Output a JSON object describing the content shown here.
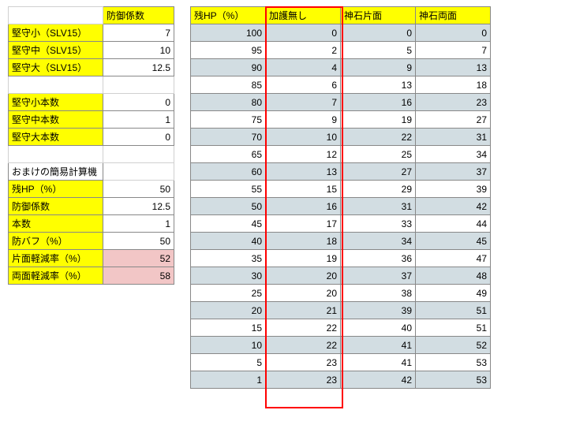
{
  "left": {
    "header1": "防御係数",
    "r1": {
      "label": "堅守小（SLV15）",
      "val": "7"
    },
    "r2": {
      "label": "堅守中（SLV15）",
      "val": "10"
    },
    "r3": {
      "label": "堅守大（SLV15）",
      "val": "12.5"
    },
    "r4": {
      "label": "堅守小本数",
      "val": "0"
    },
    "r5": {
      "label": "堅守中本数",
      "val": "1"
    },
    "r6": {
      "label": "堅守大本数",
      "val": "0"
    },
    "calc_title": "おまけの簡易計算機",
    "c1": {
      "label": "残HP（%）",
      "val": "50"
    },
    "c2": {
      "label": "防御係数",
      "val": "12.5"
    },
    "c3": {
      "label": "本数",
      "val": "1"
    },
    "c4": {
      "label": "防バフ（%）",
      "val": "50"
    },
    "c5": {
      "label": "片面軽減率（%）",
      "val": "52"
    },
    "c6": {
      "label": "両面軽減率（%）",
      "val": "58"
    }
  },
  "right": {
    "headers": {
      "h1": "残HP（%）",
      "h2": "加護無し",
      "h3": "神石片面",
      "h4": "神石両面"
    },
    "rows": [
      {
        "hp": "100",
        "a": "0",
        "b": "0",
        "c": "0"
      },
      {
        "hp": "95",
        "a": "2",
        "b": "5",
        "c": "7"
      },
      {
        "hp": "90",
        "a": "4",
        "b": "9",
        "c": "13"
      },
      {
        "hp": "85",
        "a": "6",
        "b": "13",
        "c": "18"
      },
      {
        "hp": "80",
        "a": "7",
        "b": "16",
        "c": "23"
      },
      {
        "hp": "75",
        "a": "9",
        "b": "19",
        "c": "27"
      },
      {
        "hp": "70",
        "a": "10",
        "b": "22",
        "c": "31"
      },
      {
        "hp": "65",
        "a": "12",
        "b": "25",
        "c": "34"
      },
      {
        "hp": "60",
        "a": "13",
        "b": "27",
        "c": "37"
      },
      {
        "hp": "55",
        "a": "15",
        "b": "29",
        "c": "39"
      },
      {
        "hp": "50",
        "a": "16",
        "b": "31",
        "c": "42"
      },
      {
        "hp": "45",
        "a": "17",
        "b": "33",
        "c": "44"
      },
      {
        "hp": "40",
        "a": "18",
        "b": "34",
        "c": "45"
      },
      {
        "hp": "35",
        "a": "19",
        "b": "36",
        "c": "47"
      },
      {
        "hp": "30",
        "a": "20",
        "b": "37",
        "c": "48"
      },
      {
        "hp": "25",
        "a": "20",
        "b": "38",
        "c": "49"
      },
      {
        "hp": "20",
        "a": "21",
        "b": "39",
        "c": "51"
      },
      {
        "hp": "15",
        "a": "22",
        "b": "40",
        "c": "51"
      },
      {
        "hp": "10",
        "a": "22",
        "b": "41",
        "c": "52"
      },
      {
        "hp": "5",
        "a": "23",
        "b": "41",
        "c": "53"
      },
      {
        "hp": "1",
        "a": "23",
        "b": "42",
        "c": "53"
      }
    ]
  }
}
